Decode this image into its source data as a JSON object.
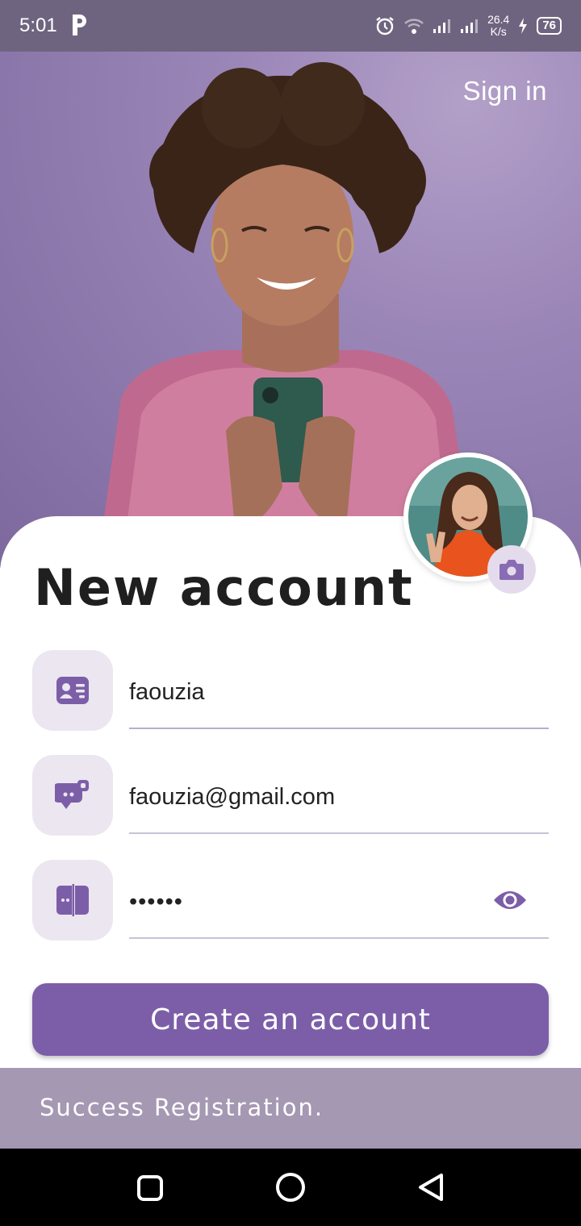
{
  "status_bar": {
    "time": "5:01",
    "speed_value": "26.4",
    "speed_unit": "K/s",
    "battery": "76"
  },
  "header": {
    "sign_in_label": "Sign in"
  },
  "form": {
    "title": "New account",
    "name_value": "faouzia",
    "email_value": "faouzia@gmail.com",
    "password_value": "••••••",
    "submit_label": "Create an account"
  },
  "snackbar": {
    "message": "Success Registration."
  },
  "colors": {
    "accent": "#7c5ea8",
    "icon_bg": "#ebe6f0",
    "snackbar_bg": "#a598b3"
  },
  "icons": {
    "name_field": "contact-card-icon",
    "email_field": "chat-bubble-icon",
    "password_field": "book-icon",
    "visibility": "eye-icon",
    "camera": "camera-icon"
  }
}
